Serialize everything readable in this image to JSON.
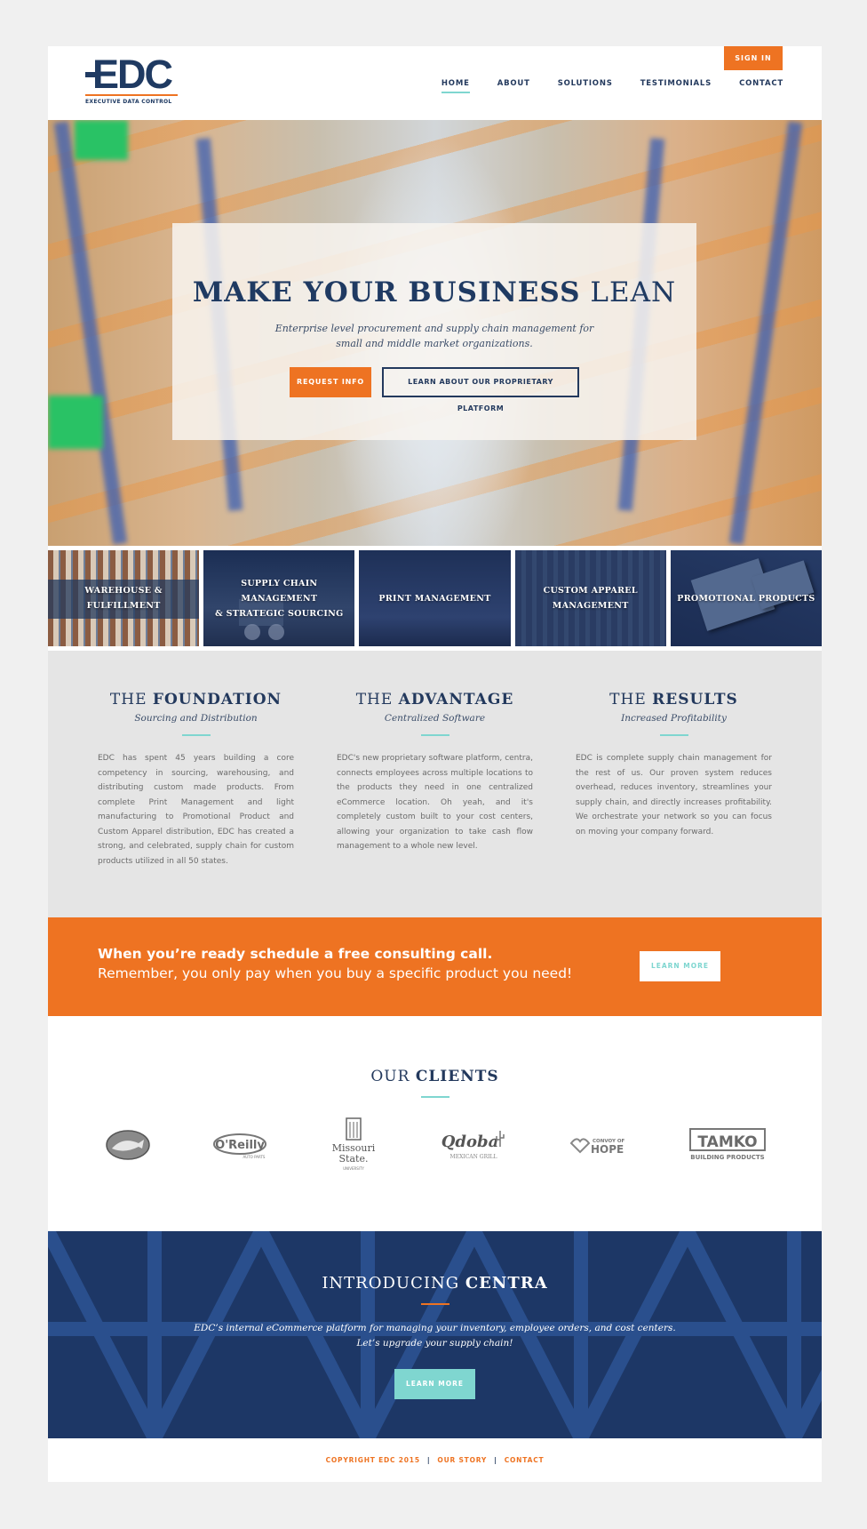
{
  "header": {
    "logo": {
      "mark": "EDC",
      "subtitle": "EXECUTIVE DATA CONTROL"
    },
    "sign_in": "SIGN IN",
    "nav": [
      {
        "label": "HOME",
        "active": true
      },
      {
        "label": "ABOUT"
      },
      {
        "label": "SOLUTIONS"
      },
      {
        "label": "TESTIMONIALS"
      },
      {
        "label": "CONTACT"
      }
    ]
  },
  "hero": {
    "title_bold": "MAKE YOUR BUSINESS",
    "title_light": "LEAN",
    "subtitle_line1": "Enterprise level procurement and supply chain management for",
    "subtitle_line2": "small and middle market organizations.",
    "primary_button": "REQUEST INFO",
    "secondary_button": "LEARN ABOUT OUR PROPRIETARY PLATFORM"
  },
  "tiles": [
    {
      "line1": "WAREHOUSE & FULFILLMENT",
      "line2": ""
    },
    {
      "line1": "SUPPLY CHAIN MANAGEMENT",
      "line2": "& STRATEGIC SOURCING"
    },
    {
      "line1": "PRINT MANAGEMENT",
      "line2": ""
    },
    {
      "line1": "CUSTOM APPAREL",
      "line2": "MANAGEMENT"
    },
    {
      "line1": "PROMOTIONAL PRODUCTS",
      "line2": ""
    }
  ],
  "features": [
    {
      "title_light": "THE",
      "title_bold": "FOUNDATION",
      "subtitle": "Sourcing and Distribution",
      "body": "EDC has spent 45 years building a core competency in sourcing, warehousing, and distributing custom made products. From complete Print Management and light manufacturing to Promotional Product and Custom Apparel distribution, EDC has created a strong, and celebrated, supply chain for custom products utilized in all 50 states."
    },
    {
      "title_light": "THE",
      "title_bold": "ADVANTAGE",
      "subtitle": "Centralized Software",
      "body": "EDC's new proprietary software platform, centra, connects employees across multiple locations to the products they need in one centralized eCommerce location. Oh yeah, and it's completely custom built to your cost centers, allowing your organization to take cash flow management to a whole new level."
    },
    {
      "title_light": "THE",
      "title_bold": "RESULTS",
      "subtitle": "Increased Profitability",
      "body": "EDC is complete supply chain management for the rest of us. Our proven system reduces overhead, reduces inventory, streamlines your supply chain, and directly increases profitability. We orchestrate your network so you can focus on moving your company forward."
    }
  ],
  "cta": {
    "line1": "When you’re ready schedule a free consulting call.",
    "line2": "Remember, you only pay when you buy a specific product you need!",
    "button": "LEARN MORE"
  },
  "clients": {
    "title_light": "OUR",
    "title_bold": "CLIENTS",
    "logos": {
      "bass": "Bass Pro Shops",
      "oreilly": "O'Reilly",
      "oreilly_sub": "AUTO PARTS",
      "missouri1": "Missouri",
      "missouri2": "State.",
      "missouri3": "UNIVERSITY",
      "qdoba": "Qdoba",
      "qdoba_sub": "MEXICAN GRILL",
      "convoy_small": "CONVOY OF",
      "convoy_big": "HOPE",
      "tamko": "TAMKO",
      "tamko_sub": "BUILDING PRODUCTS"
    }
  },
  "centra": {
    "title_light": "INTRODUCING",
    "title_bold": "CENTRA",
    "line1": "EDC’s internal eCommerce platform for managing your inventory, employee orders, and cost centers.",
    "line2": "Let’s upgrade your supply chain!",
    "button": "LEARN MORE"
  },
  "footer": {
    "copyright": "COPYRIGHT EDC 2015",
    "sep": "|",
    "our_story": "OUR STORY",
    "contact": "CONTACT"
  },
  "colors": {
    "navy": "#23395d",
    "orange": "#ee7322",
    "teal": "#7fd6d0",
    "light_gray": "#e5e5e5"
  },
  "icons": [
    "logo-mark",
    "client-logos"
  ]
}
